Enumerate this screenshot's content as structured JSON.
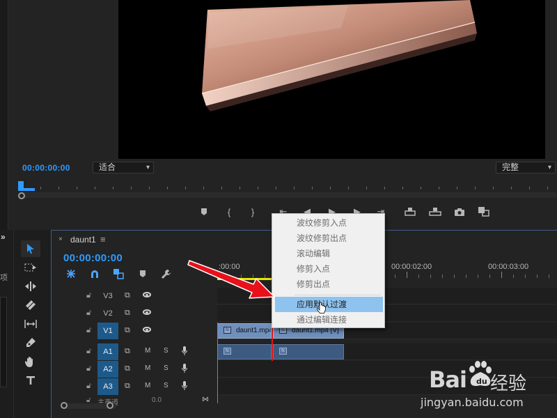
{
  "monitor": {
    "timecode": "00:00:00:00",
    "fit_select": "适合",
    "quality_select": "完整"
  },
  "timeline": {
    "tab_label": "daunt1",
    "tab_close": "×",
    "tab_menu": "≡",
    "timecode": "00:00:00:00",
    "ruler_labels": [
      ":00:00",
      "00:00:02:00",
      "00:00:03:00"
    ],
    "tracks": [
      {
        "name": "V3",
        "type": "video"
      },
      {
        "name": "V2",
        "type": "video"
      },
      {
        "name": "V1",
        "type": "video",
        "selected": true
      },
      {
        "name": "A1",
        "type": "audio",
        "selected": true
      },
      {
        "name": "A2",
        "type": "audio",
        "selected": true
      },
      {
        "name": "A3",
        "type": "audio",
        "selected": true
      }
    ],
    "mute_label": "M",
    "solo_label": "S",
    "clips": {
      "v1_clip_1": "daunt1.mp4",
      "v1_clip_2": "daunt1.mp4 [V]"
    },
    "master_label": "主声道",
    "master_value": "0.0",
    "fx_badge": "fx"
  },
  "sidebar": {
    "label": "项"
  },
  "context_menu": {
    "items": [
      {
        "label": "波纹修剪入点",
        "enabled": false
      },
      {
        "label": "波纹修剪出点",
        "enabled": false
      },
      {
        "label": "滚动编辑",
        "enabled": false
      },
      {
        "label": "修剪入点",
        "enabled": false
      },
      {
        "label": "修剪出点",
        "enabled": false
      },
      {
        "label": "应用默认过渡",
        "enabled": true,
        "highlighted": true
      },
      {
        "label": "通过编辑连接",
        "enabled": false
      }
    ]
  },
  "watermark": {
    "brand": "Bai",
    "brand_suffix": "经验",
    "url": "jingyan.baidu.com"
  },
  "colors": {
    "accent_blue": "#2e9bff",
    "track_selected": "#1d5a8a",
    "video_clip": "#6f8fbc",
    "audio_clip": "#3d5a80",
    "cut_line": "#e01515",
    "menu_highlight": "#8ec3ef",
    "arrow_red": "#e8101a"
  },
  "icons": [
    "marker-icon",
    "mark-in-icon",
    "mark-out-icon",
    "step-back-icon",
    "play-icon",
    "step-forward-icon",
    "lift-icon",
    "extract-icon",
    "camera-icon",
    "compare-icon",
    "selection-tool-icon",
    "track-select-icon",
    "ripple-edit-icon",
    "razor-icon",
    "slip-icon",
    "pen-icon",
    "hand-icon",
    "type-icon",
    "snap-icon",
    "linked-selection-icon",
    "add-marker-icon",
    "wrench-icon",
    "lock-icon",
    "eye-icon",
    "mic-icon"
  ]
}
